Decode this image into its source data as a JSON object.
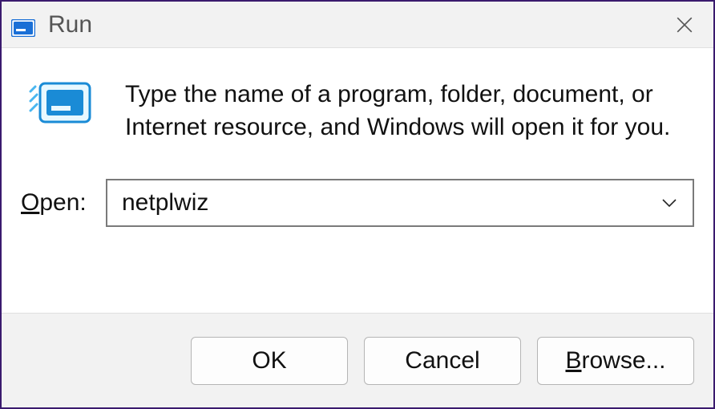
{
  "titlebar": {
    "title": "Run"
  },
  "body": {
    "description": "Type the name of a program, folder, document, or Internet resource, and Windows will open it for you.",
    "open_label_pre": "O",
    "open_label_post": "pen:",
    "open_value": "netplwiz"
  },
  "footer": {
    "ok_label": "OK",
    "cancel_label": "Cancel",
    "browse_pre": "B",
    "browse_post": "rowse..."
  }
}
